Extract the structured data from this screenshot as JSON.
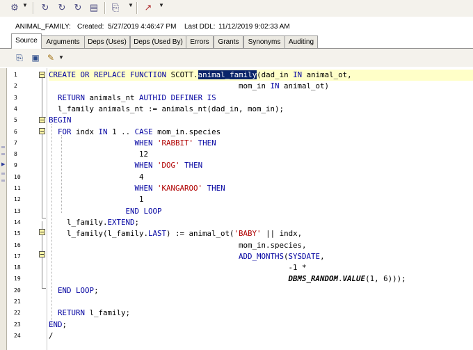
{
  "toolbar": {
    "buttons": [
      {
        "name": "connection-icon",
        "glyph": "⚙"
      },
      {
        "name": "refresh-icon",
        "glyph": "↻"
      },
      {
        "name": "refresh-object-icon",
        "glyph": "↻"
      },
      {
        "name": "refresh-all-icon",
        "glyph": "↻"
      },
      {
        "name": "properties-icon",
        "glyph": "▤"
      },
      {
        "name": "script-icon",
        "glyph": "⎘"
      },
      {
        "name": "navigate-icon",
        "glyph": "↗"
      }
    ]
  },
  "object_info": {
    "name": "ANIMAL_FAMILY:",
    "created_label": "Created:",
    "created_value": "5/27/2019 4:46:47 PM",
    "last_ddl_label": "Last DDL:",
    "last_ddl_value": "11/12/2019 9:02:33 AM"
  },
  "tabs": [
    {
      "label": "Source",
      "active": true
    },
    {
      "label": "Arguments",
      "active": false
    },
    {
      "label": "Deps (Uses)",
      "active": false
    },
    {
      "label": "Deps (Used By)",
      "active": false
    },
    {
      "label": "Errors",
      "active": false
    },
    {
      "label": "Grants",
      "active": false
    },
    {
      "label": "Synonyms",
      "active": false
    },
    {
      "label": "Auditing",
      "active": false
    }
  ],
  "editor_toolbar": [
    {
      "name": "copy-icon",
      "glyph": "⎘"
    },
    {
      "name": "save-icon",
      "glyph": "▣"
    },
    {
      "name": "highlight-icon",
      "glyph": "✎"
    }
  ],
  "colors": {
    "keyword": "#0000a0",
    "string": "#b00000",
    "selection": "#0a246a",
    "current_line": "#ffffc8",
    "fold_marker": "#fff8a8"
  },
  "line_numbers": [
    "1",
    "2",
    "3",
    "4",
    "5",
    "6",
    "7",
    "8",
    "9",
    "10",
    "11",
    "12",
    "13",
    "14",
    "15",
    "16",
    "17",
    "18",
    "19",
    "20",
    "21",
    "22",
    "23",
    "24"
  ],
  "code_lines": [
    [
      {
        "t": "CREATE",
        "c": "k"
      },
      {
        "t": " "
      },
      {
        "t": "OR",
        "c": "k"
      },
      {
        "t": " "
      },
      {
        "t": "REPLACE",
        "c": "k"
      },
      {
        "t": " "
      },
      {
        "t": "FUNCTION",
        "c": "k"
      },
      {
        "t": " SCOTT."
      },
      {
        "t": "animal_family",
        "c": "sel"
      },
      {
        "t": "(dad_in "
      },
      {
        "t": "IN",
        "c": "k"
      },
      {
        "t": " animal_ot,"
      }
    ],
    [
      {
        "t": "                                          mom_in "
      },
      {
        "t": "IN",
        "c": "k"
      },
      {
        "t": " animal_ot)"
      }
    ],
    [
      {
        "t": "  "
      },
      {
        "t": "RETURN",
        "c": "k"
      },
      {
        "t": " animals_nt "
      },
      {
        "t": "AUTHID",
        "c": "k"
      },
      {
        "t": " "
      },
      {
        "t": "DEFINER",
        "c": "k"
      },
      {
        "t": " "
      },
      {
        "t": "IS",
        "c": "k"
      }
    ],
    [
      {
        "t": "  l_family animals_nt := animals_nt(dad_in, mom_in);"
      }
    ],
    [
      {
        "t": "BEGIN",
        "c": "k"
      }
    ],
    [
      {
        "t": "  "
      },
      {
        "t": "FOR",
        "c": "k"
      },
      {
        "t": " indx "
      },
      {
        "t": "IN",
        "c": "k"
      },
      {
        "t": " 1 .. "
      },
      {
        "t": "CASE",
        "c": "k"
      },
      {
        "t": " mom_in.species"
      }
    ],
    [
      {
        "t": "                   "
      },
      {
        "t": "WHEN",
        "c": "k"
      },
      {
        "t": " "
      },
      {
        "t": "'RABBIT'",
        "c": "s"
      },
      {
        "t": " "
      },
      {
        "t": "THEN",
        "c": "k"
      }
    ],
    [
      {
        "t": "                    12"
      }
    ],
    [
      {
        "t": "                   "
      },
      {
        "t": "WHEN",
        "c": "k"
      },
      {
        "t": " "
      },
      {
        "t": "'DOG'",
        "c": "s"
      },
      {
        "t": " "
      },
      {
        "t": "THEN",
        "c": "k"
      }
    ],
    [
      {
        "t": "                    4"
      }
    ],
    [
      {
        "t": "                   "
      },
      {
        "t": "WHEN",
        "c": "k"
      },
      {
        "t": " "
      },
      {
        "t": "'KANGAROO'",
        "c": "s"
      },
      {
        "t": " "
      },
      {
        "t": "THEN",
        "c": "k"
      }
    ],
    [
      {
        "t": "                    1"
      }
    ],
    [
      {
        "t": "                 "
      },
      {
        "t": "END",
        "c": "k"
      },
      {
        "t": " "
      },
      {
        "t": "LOOP",
        "c": "k"
      }
    ],
    [
      {
        "t": "    l_family."
      },
      {
        "t": "EXTEND",
        "c": "k"
      },
      {
        "t": ";"
      }
    ],
    [
      {
        "t": "    l_family(l_family."
      },
      {
        "t": "LAST",
        "c": "k"
      },
      {
        "t": ") := animal_ot("
      },
      {
        "t": "'BABY'",
        "c": "s"
      },
      {
        "t": " || indx,"
      }
    ],
    [
      {
        "t": "                                          mom_in.species,"
      }
    ],
    [
      {
        "t": "                                          "
      },
      {
        "t": "ADD_MONTHS",
        "c": "k"
      },
      {
        "t": "("
      },
      {
        "t": "SYSDATE",
        "c": "k"
      },
      {
        "t": ","
      }
    ],
    [
      {
        "t": "                                                     -1 *"
      }
    ],
    [
      {
        "t": "                                                     "
      },
      {
        "t": "DBMS_RANDOM",
        "c": "bi"
      },
      {
        "t": "."
      },
      {
        "t": "VALUE",
        "c": "bi"
      },
      {
        "t": "(1, 6)));"
      }
    ],
    [
      {
        "t": "  "
      },
      {
        "t": "END",
        "c": "k"
      },
      {
        "t": " "
      },
      {
        "t": "LOOP",
        "c": "k"
      },
      {
        "t": ";"
      }
    ],
    [
      {
        "t": ""
      }
    ],
    [
      {
        "t": "  "
      },
      {
        "t": "RETURN",
        "c": "k"
      },
      {
        "t": " l_family;"
      }
    ],
    [
      {
        "t": "END",
        "c": "k"
      },
      {
        "t": ";"
      }
    ],
    [
      {
        "t": "/"
      }
    ]
  ]
}
